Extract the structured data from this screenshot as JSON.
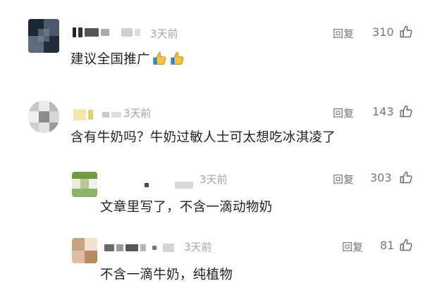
{
  "comments": [
    {
      "time": "3天前",
      "reply_label": "回复",
      "likes": "310",
      "text": "建议全国推广",
      "emoji": [
        "thumbs-up-emoji",
        "thumbs-up-emoji"
      ]
    },
    {
      "time": "3天前",
      "reply_label": "回复",
      "likes": "143",
      "text": "含有牛奶吗？牛奶过敏人士可太想吃冰淇凌了"
    },
    {
      "time": "3天前",
      "reply_label": "回复",
      "likes": "303",
      "text": "文章里写了，不含一滴动物奶"
    },
    {
      "time": "3天前",
      "reply_label": "回复",
      "likes": "81",
      "text": "不含一滴牛奶，纯植物"
    }
  ],
  "icons": {
    "like": "thumbs-up-outline-icon"
  }
}
